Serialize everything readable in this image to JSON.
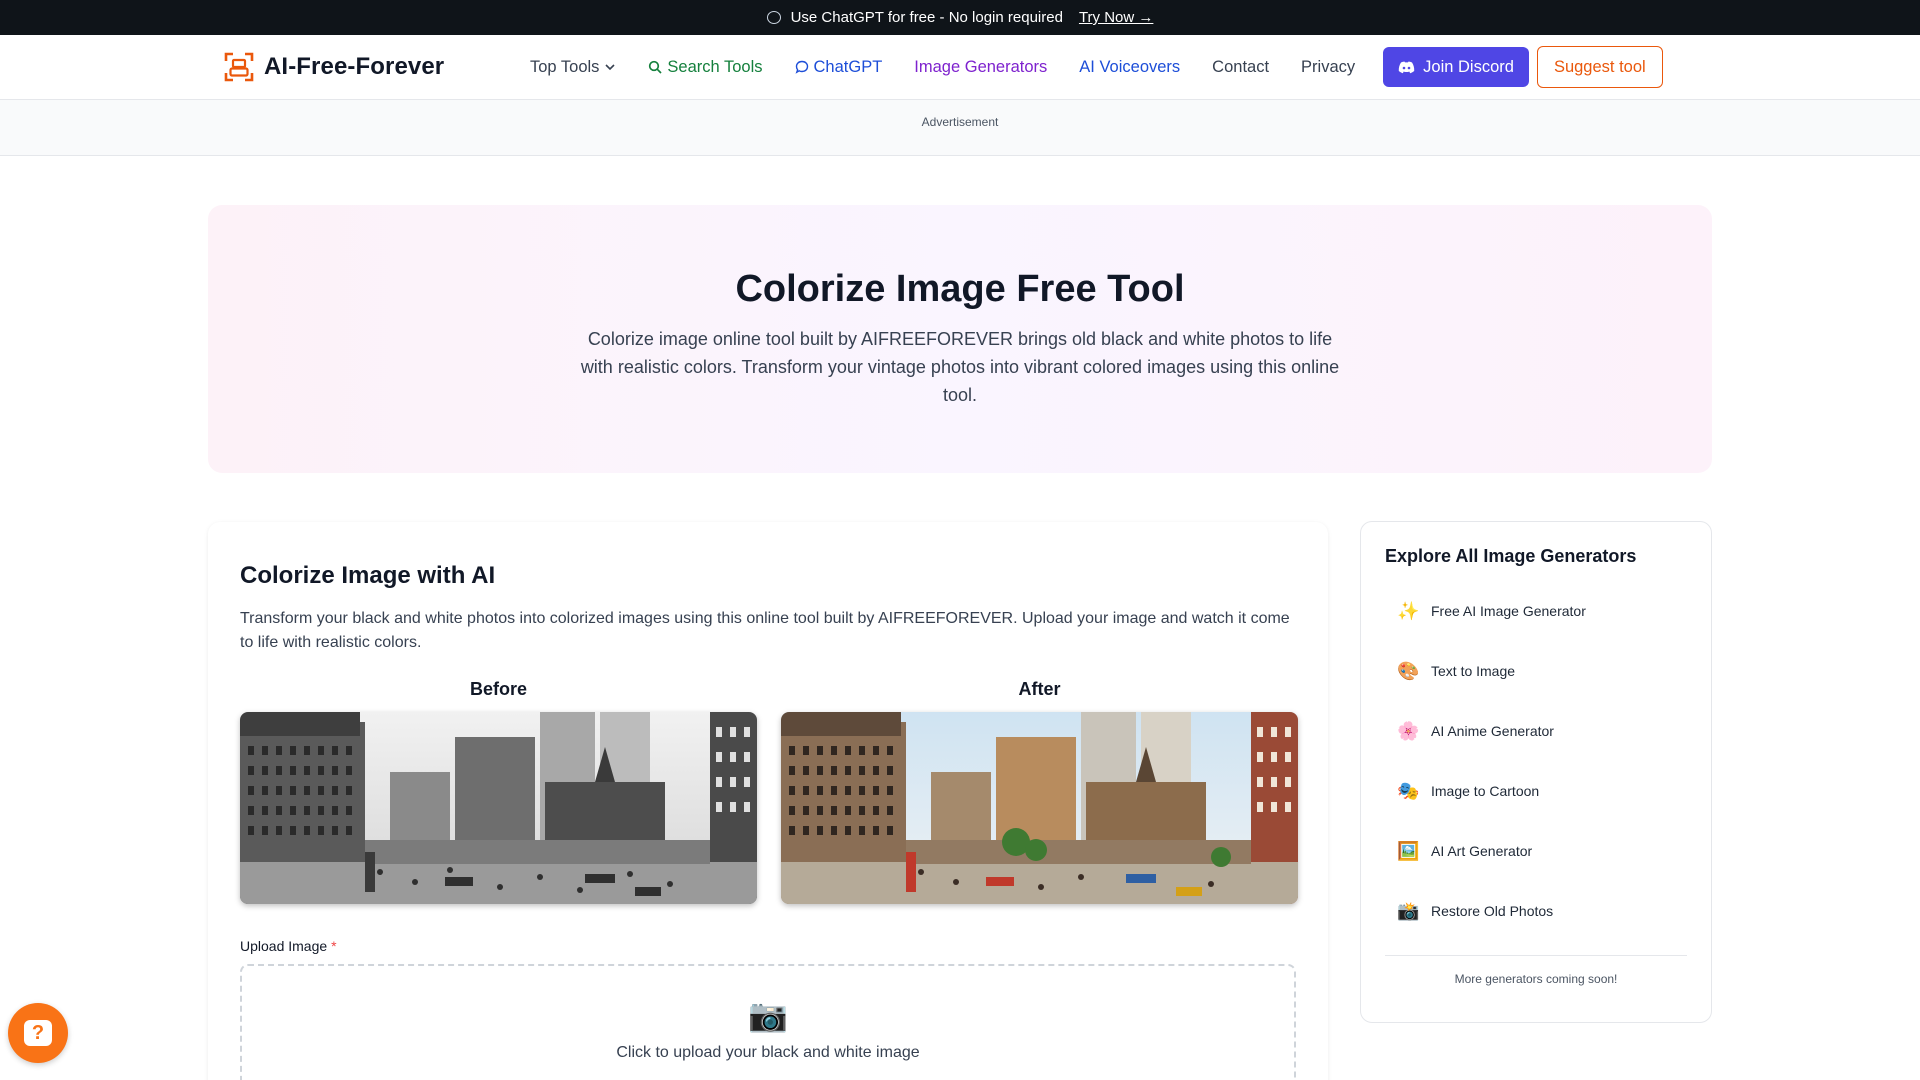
{
  "banner": {
    "text": "Use ChatGPT for free - No login required",
    "link": "Try Now →"
  },
  "header": {
    "logo": "AI-Free-Forever",
    "nav": {
      "top_tools": "Top Tools",
      "search_tools": "Search Tools",
      "chatgpt": "ChatGPT",
      "image_generators": "Image Generators",
      "ai_voiceovers": "AI Voiceovers",
      "contact": "Contact",
      "privacy": "Privacy"
    },
    "discord": "Join Discord",
    "suggest": "Suggest tool"
  },
  "ad": {
    "label": "Advertisement"
  },
  "hero": {
    "title": "Colorize Image Free Tool",
    "description": "Colorize image online tool built by AIFREEFOREVER brings old black and white photos to life with realistic colors. Transform your vintage photos into vibrant colored images using this online tool."
  },
  "main": {
    "title": "Colorize Image with AI",
    "description": "Transform your black and white photos into colorized images using this online tool built by AIFREEFOREVER. Upload your image and watch it come to life with realistic colors.",
    "before": "Before",
    "after": "After",
    "upload_label": "Upload Image",
    "required_mark": "*",
    "upload_text": "Click to upload your black and white image"
  },
  "sidebar": {
    "title": "Explore All Image Generators",
    "items": [
      {
        "icon": "✨",
        "label": "Free AI Image Generator"
      },
      {
        "icon": "🎨",
        "label": "Text to Image"
      },
      {
        "icon": "🌸",
        "label": "AI Anime Generator"
      },
      {
        "icon": "🎭",
        "label": "Image to Cartoon"
      },
      {
        "icon": "🖼️",
        "label": "AI Art Generator"
      },
      {
        "icon": "📸",
        "label": "Restore Old Photos"
      }
    ],
    "more": "More generators coming soon!"
  },
  "help": {
    "glyph": "?"
  }
}
